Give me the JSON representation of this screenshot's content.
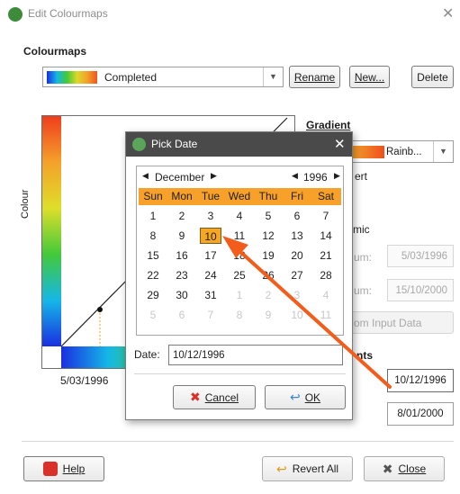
{
  "window": {
    "title": "Edit Colourmaps"
  },
  "colourmaps": {
    "section_label": "Colourmaps",
    "selected": "Completed",
    "rename_label": "Rename",
    "new_label": "New...",
    "delete_label": "Delete"
  },
  "graph": {
    "y_axis_label": "Colour",
    "min_label": "5/03/1996"
  },
  "gradient": {
    "heading": "Gradient",
    "selected": "Rainb...",
    "invert_label_partial": "ert"
  },
  "dynamic": {
    "label_partial": "mic",
    "minimum_label_partial": "um:",
    "minimum_value": "5/03/1996",
    "maximum_label_partial": "um:",
    "maximum_value": "15/10/2000",
    "from_input_partial": "om Input Data"
  },
  "control_points": {
    "heading_partial": "nts",
    "values": [
      "10/12/1996",
      "8/01/2000"
    ]
  },
  "pick_date": {
    "title": "Pick Date",
    "month": "December",
    "year": "1996",
    "weekdays": [
      "Sun",
      "Mon",
      "Tue",
      "Wed",
      "Thu",
      "Fri",
      "Sat"
    ],
    "weeks": [
      [
        "1",
        "2",
        "3",
        "4",
        "5",
        "6",
        "7"
      ],
      [
        "8",
        "9",
        "10",
        "11",
        "12",
        "13",
        "14"
      ],
      [
        "15",
        "16",
        "17",
        "18",
        "19",
        "20",
        "21"
      ],
      [
        "22",
        "23",
        "24",
        "25",
        "26",
        "27",
        "28"
      ],
      [
        "29",
        "30",
        "31",
        "1",
        "2",
        "3",
        "4"
      ],
      [
        "5",
        "6",
        "7",
        "8",
        "9",
        "10",
        "11"
      ]
    ],
    "selected_day": "10",
    "date_label": "Date:",
    "date_value": "10/12/1996",
    "cancel_label": "Cancel",
    "ok_label": "OK"
  },
  "footer": {
    "help_label": "Help",
    "revert_label": "Revert All",
    "close_label": "Close"
  },
  "colors": {
    "accent_orange": "#f7a12b",
    "selected_day": "#f5a623",
    "arrow": "#f25d1c"
  }
}
